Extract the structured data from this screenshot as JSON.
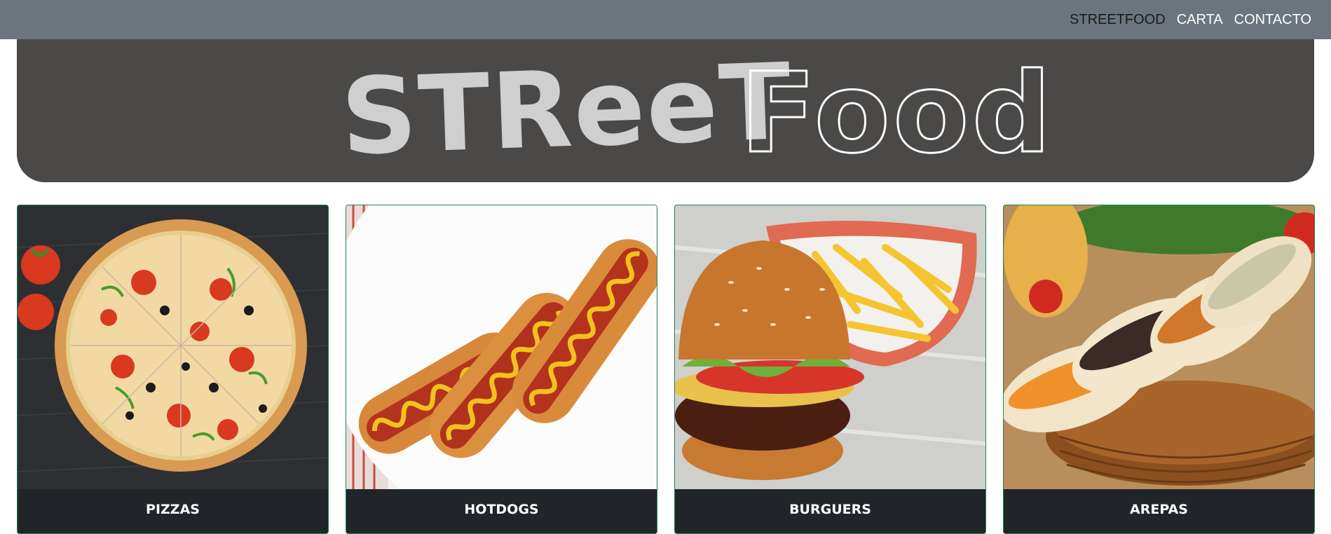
{
  "navbar": {
    "links": [
      {
        "label": "STREETFOOD",
        "active": true
      },
      {
        "label": "CARTA",
        "active": false
      },
      {
        "label": "CONTACTO",
        "active": false
      }
    ]
  },
  "hero": {
    "logo_text_left": "STReeT",
    "logo_text_right": "Food"
  },
  "cards": [
    {
      "title": "PIZZAS",
      "image": "pizza-photo"
    },
    {
      "title": "HOTDOGS",
      "image": "hotdogs-photo"
    },
    {
      "title": "BURGUERS",
      "image": "burger-photo"
    },
    {
      "title": "AREPAS",
      "image": "arepas-photo"
    }
  ],
  "colors": {
    "navbar": "#6c757d",
    "hero": "#4a4948",
    "card_footer": "#212529",
    "card_border": "#198754"
  }
}
